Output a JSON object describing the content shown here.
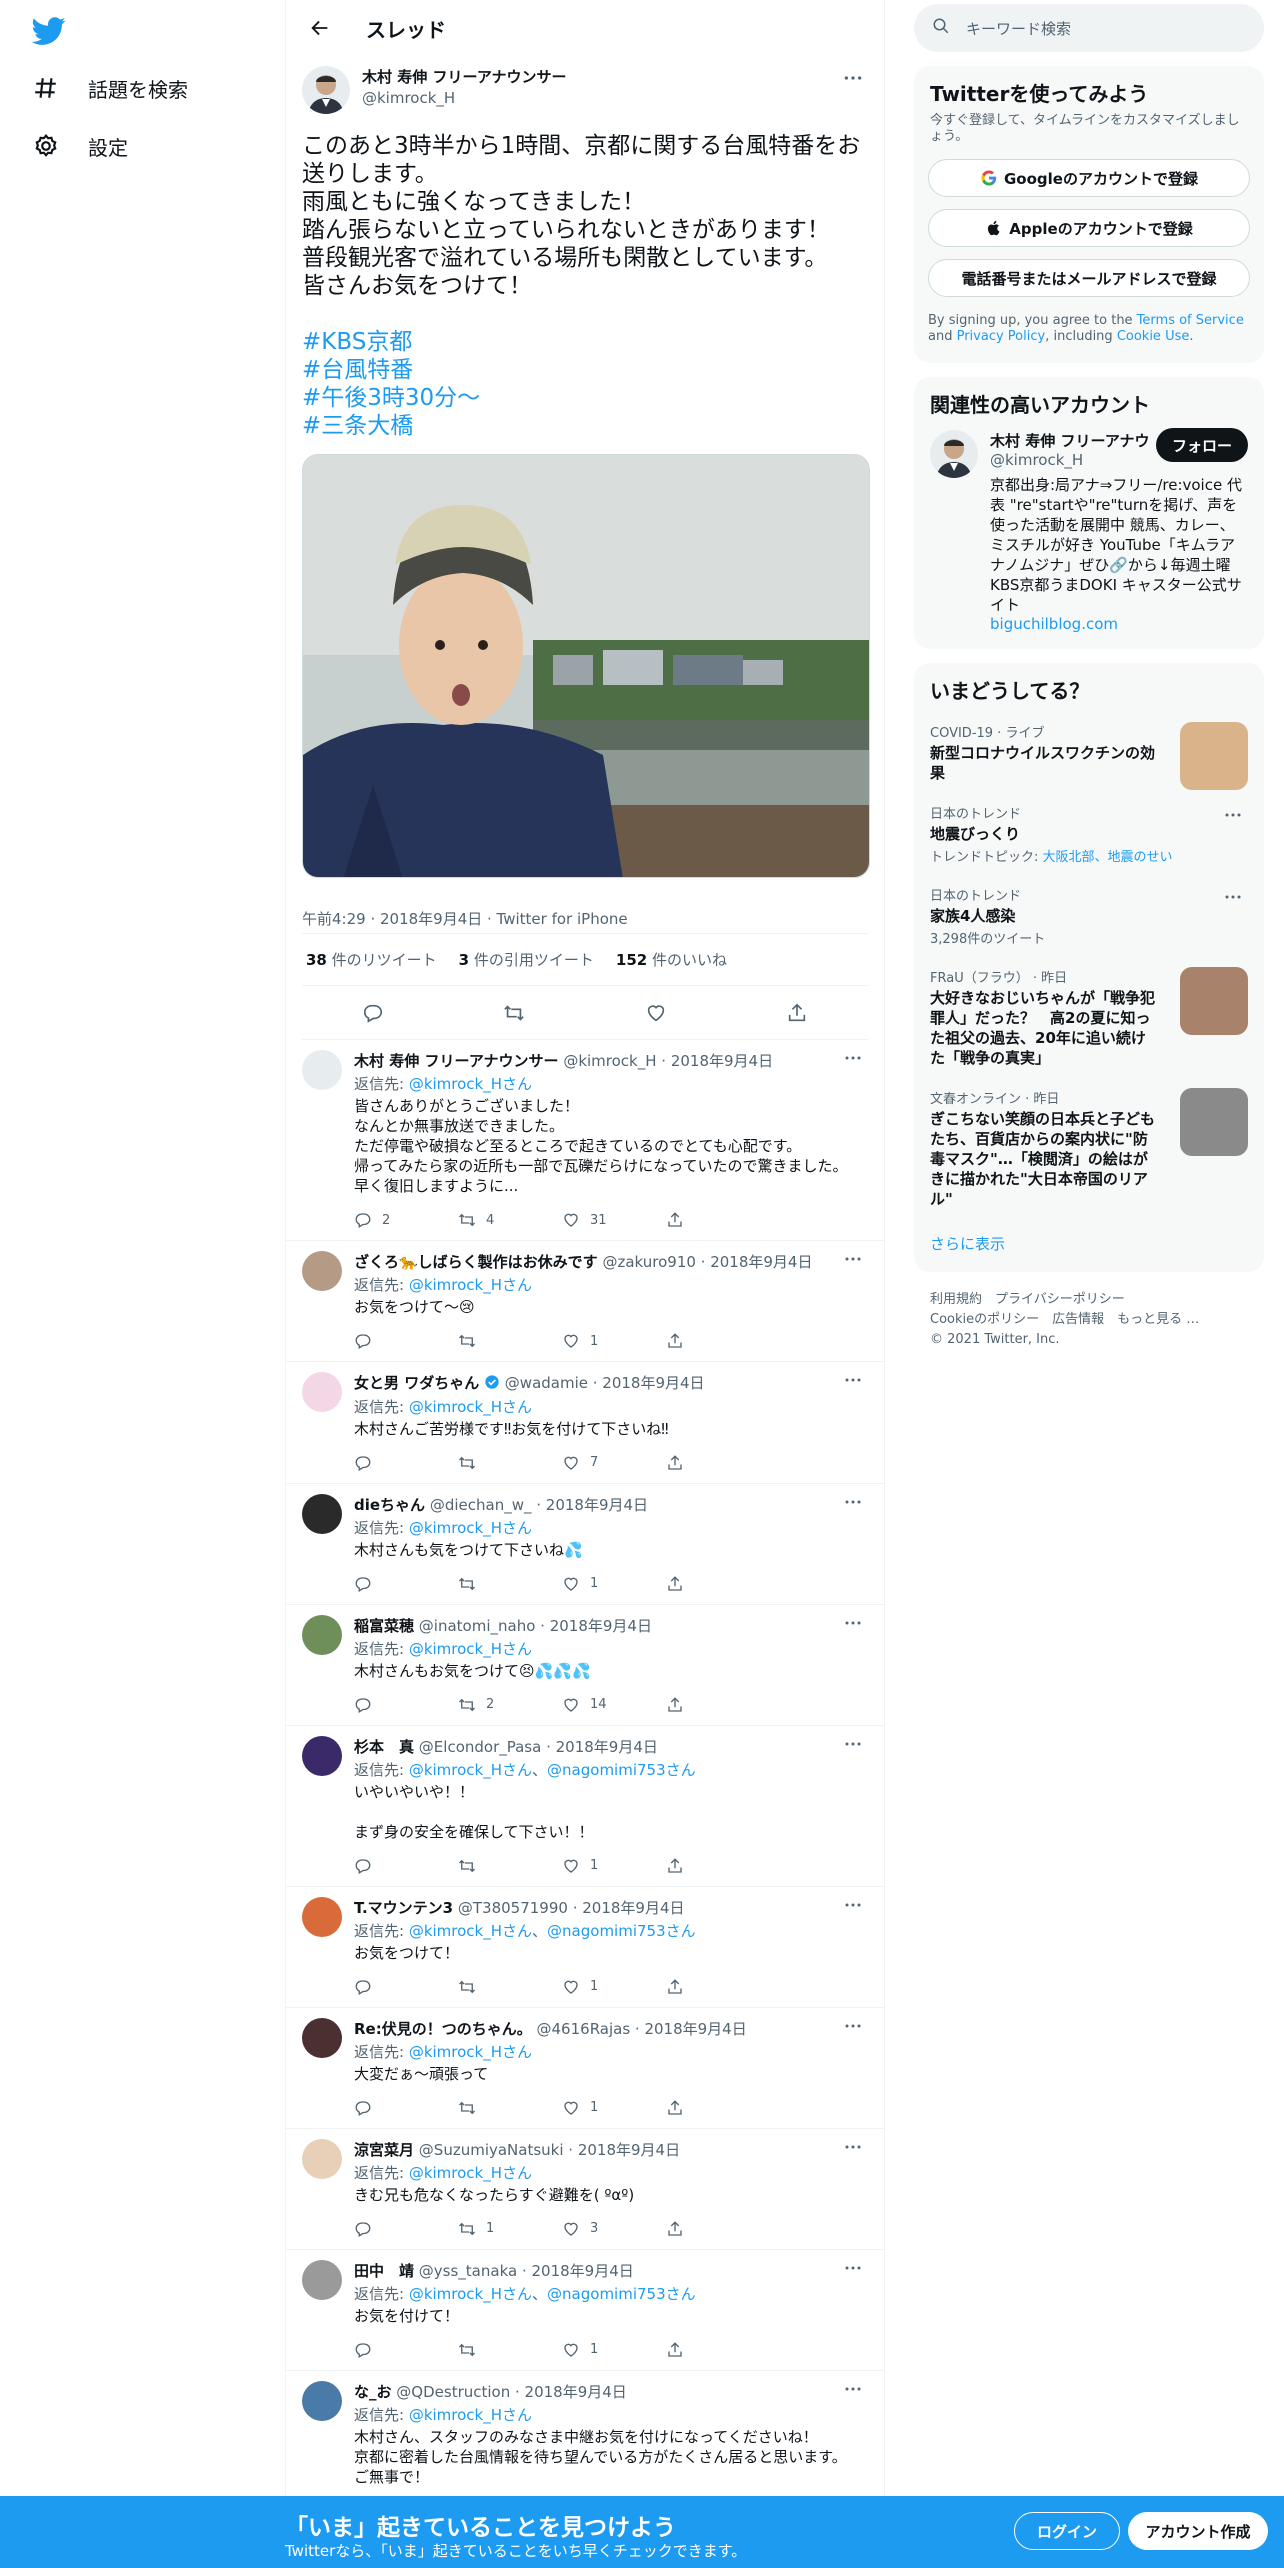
{
  "colors": {
    "accent": "#1d9bf0",
    "text": "#0f1419",
    "muted": "#536471"
  },
  "nav": {
    "items": [
      {
        "label": "話題を検索",
        "icon": "hashtag-icon"
      },
      {
        "label": "設定",
        "icon": "gear-icon"
      }
    ]
  },
  "header": {
    "title": "スレッド"
  },
  "main_tweet": {
    "name": "木村 寿伸 フリーアナウンサー",
    "handle": "@kimrock_H",
    "text_lines": [
      "このあと3時半から1時間、京都に関する台風特番をお",
      "送りします。",
      "雨風ともに強くなってきました！",
      "踏ん張らないと立っていられないときがあります！",
      "普段観光客で溢れている場所も閑散としています。",
      "皆さんお気をつけて！"
    ],
    "hashtags": [
      "#KBS京都",
      "#台風特番",
      "#午後3時30分〜",
      "#三条大橋"
    ],
    "meta": "午前4:29 · 2018年9月4日 · Twitter for iPhone",
    "retweets": "38",
    "retweets_label": "件のリツイート",
    "quotes": "3",
    "quotes_label": "件の引用ツイート",
    "likes": "152",
    "likes_label": "件のいいね"
  },
  "replies": [
    {
      "name": "木村 寿伸 フリーアナウンサー",
      "handle": "@kimrock_H · 2018年9月4日",
      "reply_prefix": "返信先: ",
      "reply_to": "@kimrock_Hさん",
      "reply_to2": "",
      "text": "皆さんありがとうございました！\nなんとか無事放送できました。\nただ停電や破損など至るところで起きているのでとても心配です。\n帰ってみたら家の近所も一部で瓦礫だらけになっていたので驚きました。\n早く復旧しますように...",
      "replies": "2",
      "retweets": "4",
      "likes": "31"
    },
    {
      "name": "ざくろ🐆しばらく製作はお休みです",
      "handle": "@zakuro910 · 2018年9月4日",
      "reply_prefix": "返信先: ",
      "reply_to": "@kimrock_Hさん",
      "reply_to2": "",
      "text": "お気をつけて～😢",
      "replies": "",
      "retweets": "",
      "likes": "1"
    },
    {
      "name": "女と男 ワダちゃん",
      "handle": "@wadamie · 2018年9月4日",
      "verified": true,
      "reply_prefix": "返信先: ",
      "reply_to": "@kimrock_Hさん",
      "reply_to2": "",
      "text": "木村さんご苦労様です‼お気を付けて下さいね‼",
      "replies": "",
      "retweets": "",
      "likes": "7"
    },
    {
      "name": "dieちゃん",
      "handle": "@diechan_w_ · 2018年9月4日",
      "reply_prefix": "返信先: ",
      "reply_to": "@kimrock_Hさん",
      "reply_to2": "",
      "text": "木村さんも気をつけて下さいね💦",
      "replies": "",
      "retweets": "",
      "likes": "1"
    },
    {
      "name": "稲富菜穂",
      "handle": "@inatomi_naho · 2018年9月4日",
      "reply_prefix": "返信先: ",
      "reply_to": "@kimrock_Hさん",
      "reply_to2": "",
      "text": "木村さんもお気をつけて😣💦💦💦",
      "replies": "",
      "retweets": "2",
      "likes": "14"
    },
    {
      "name": "杉本　真",
      "handle": "@Elcondor_Pasa · 2018年9月4日",
      "reply_prefix": "返信先: ",
      "reply_to": "@kimrock_Hさん",
      "reply_to2": "@nagomimi753さん",
      "text": "いやいやいや！！\n\nまず身の安全を確保して下さい！！",
      "replies": "",
      "retweets": "",
      "likes": "1"
    },
    {
      "name": "T.マウンテン3",
      "handle": "@T380571990 · 2018年9月4日",
      "reply_prefix": "返信先: ",
      "reply_to": "@kimrock_Hさん",
      "reply_to2": "@nagomimi753さん",
      "text": "お気をつけて！",
      "replies": "",
      "retweets": "",
      "likes": "1"
    },
    {
      "name": "Re:伏見の！つのちゃん。",
      "handle": "@4616Rajas · 2018年9月4日",
      "reply_prefix": "返信先: ",
      "reply_to": "@kimrock_Hさん",
      "reply_to2": "",
      "text": "大変だぁ～頑張って",
      "replies": "",
      "retweets": "",
      "likes": "1"
    },
    {
      "name": "涼宮菜月",
      "handle": "@SuzumiyaNatsuki · 2018年9月4日",
      "reply_prefix": "返信先: ",
      "reply_to": "@kimrock_Hさん",
      "reply_to2": "",
      "text": "きむ兄も危なくなったらすぐ避難を( ºαº)",
      "replies": "",
      "retweets": "1",
      "likes": "3"
    },
    {
      "name": "田中　靖",
      "handle": "@yss_tanaka · 2018年9月4日",
      "reply_prefix": "返信先: ",
      "reply_to": "@kimrock_Hさん",
      "reply_to2": "@nagomimi753さん",
      "text": "お気を付けて！",
      "replies": "",
      "retweets": "",
      "likes": "1"
    },
    {
      "name": "な_お",
      "handle": "@QDestruction · 2018年9月4日",
      "reply_prefix": "返信先: ",
      "reply_to": "@kimrock_Hさん",
      "reply_to2": "",
      "text": "木村さん、スタッフのみなさま中継お気を付けになってくださいね！\n京都に密着した台風情報を待ち望んでいる方がたくさん居ると思います。\nご無事で！",
      "replies": "",
      "retweets": "",
      "likes": ""
    }
  ],
  "search": {
    "placeholder": "キーワード検索"
  },
  "signup": {
    "title": "Twitterを使ってみよう",
    "subtitle": "今すぐ登録して、タイムラインをカスタマイズしましょう。",
    "google": "Googleのアカウントで登録",
    "apple": "Appleのアカウントで登録",
    "phone": "電話番号またはメールアドレスで登録",
    "terms_1": "By signing up, you agree to the ",
    "terms_tos": "Terms of Service",
    "terms_2": " and ",
    "terms_privacy": "Privacy Policy",
    "terms_3": ", including ",
    "terms_cookie": "Cookie Use",
    "terms_4": "."
  },
  "related": {
    "title": "関連性の高いアカウント",
    "name": "木村 寿伸 フリーアナウンサー",
    "handle": "@kimrock_H",
    "follow": "フォロー",
    "bio": "京都出身:局アナ⇒フリー/re:voice 代表 \"re\"startや\"re\"turnを掲げ、声を使った活動を展開中 競馬、カレー、ミスチルが好き YouTube「キムラアナノムジナ」ぜひ🔗から↓毎週土曜 KBS京都うまDOKI キャスター公式サイト",
    "link": "biguchilblog.com"
  },
  "trends": {
    "title": "いまどうしてる？",
    "items": [
      {
        "meta": "COVID-19 · ライブ",
        "title": "新型コロナウイルスワクチンの効果",
        "sub": "",
        "has_image": true,
        "img_color": "#d9b48a"
      },
      {
        "meta": "日本のトレンド",
        "title": "地震びっくり",
        "sub": "トレンドトピック: ",
        "sub_link": "大阪北部、地震のせい",
        "has_image": false
      },
      {
        "meta": "日本のトレンド",
        "title": "家族4人感染",
        "sub": "3,298件のツイート",
        "has_image": false
      },
      {
        "meta": "FRaU（フラウ） · 昨日",
        "title": "大好きなおじいちゃんが「戦争犯罪人」だった？　高2の夏に知った祖父の過去、20年に追い続けた「戦争の真実」",
        "sub": "",
        "has_image": true,
        "img_color": "#a8826a",
        "verified": true
      },
      {
        "meta": "文春オンライン · 昨日",
        "title": "ぎこちない笑顔の日本兵と子どもたち、百貨店からの案内状に\"防毒マスク\"…「検閲済」の絵はがきに描かれた\"大日本帝国のリアル\"",
        "sub": "",
        "has_image": true,
        "img_color": "#8a8a8a",
        "verified": true
      }
    ],
    "show_more": "さらに表示"
  },
  "footer": {
    "line1": [
      "利用規約",
      "プライバシーポリシー"
    ],
    "line2": [
      "Cookieのポリシー",
      "広告情報",
      "もっと見る …"
    ],
    "copyright": "© 2021 Twitter, Inc."
  },
  "bottombar": {
    "title": "「いま」起きていることを見つけよう",
    "subtitle": "Twitterなら、「いま」起きていることをいち早くチェックできます。",
    "login": "ログイン",
    "signup": "アカウント作成"
  }
}
